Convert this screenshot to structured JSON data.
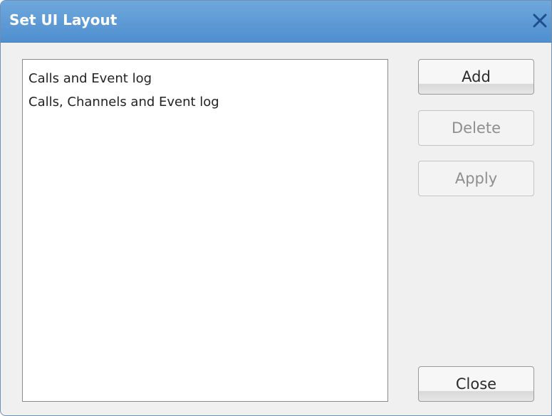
{
  "window": {
    "title": "Set UI Layout"
  },
  "layouts_list": {
    "items": [
      {
        "label": "Calls and Event log"
      },
      {
        "label": "Calls, Channels and Event log"
      }
    ]
  },
  "buttons": {
    "add": "Add",
    "delete": "Delete",
    "apply": "Apply",
    "close": "Close"
  },
  "colors": {
    "titlebar": "#5b9bd5",
    "title_text": "#ffffff",
    "dialog_bg": "#f0f0f0",
    "disabled_text": "#8f8f8f"
  },
  "icons": {
    "close": "close-icon"
  }
}
